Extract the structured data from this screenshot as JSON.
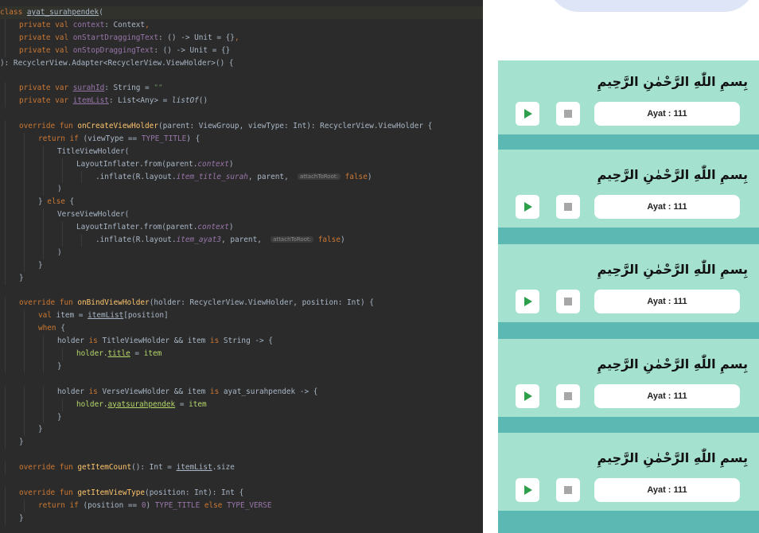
{
  "editor": {
    "lines": [
      {
        "indent": 0,
        "hl": true,
        "segs": [
          [
            "kw",
            "class "
          ],
          [
            "txu",
            "ayat_surahpendek"
          ],
          [
            "tx",
            "("
          ]
        ]
      },
      {
        "indent": 1,
        "segs": [
          [
            "kw",
            "private val "
          ],
          [
            "pp",
            "context"
          ],
          [
            "tx",
            ": Context"
          ],
          [
            "kw",
            ","
          ]
        ]
      },
      {
        "indent": 1,
        "segs": [
          [
            "kw",
            "private val "
          ],
          [
            "pp",
            "onStartDraggingText"
          ],
          [
            "tx",
            ": () -> Unit = {}"
          ],
          [
            "kw",
            ","
          ]
        ]
      },
      {
        "indent": 1,
        "segs": [
          [
            "kw",
            "private val "
          ],
          [
            "pp",
            "onStopDraggingText"
          ],
          [
            "tx",
            ": () -> Unit = {}"
          ]
        ]
      },
      {
        "indent": 0,
        "segs": [
          [
            "tx",
            "): RecyclerView.Adapter<RecyclerView.ViewHolder>() {"
          ]
        ]
      },
      {
        "indent": 0,
        "segs": []
      },
      {
        "indent": 1,
        "segs": [
          [
            "kw",
            "private var "
          ],
          [
            "ppu",
            "surahId"
          ],
          [
            "tx",
            ": String = "
          ],
          [
            "st",
            "\"\""
          ]
        ]
      },
      {
        "indent": 1,
        "segs": [
          [
            "kw",
            "private var "
          ],
          [
            "ppu",
            "itemList"
          ],
          [
            "tx",
            ": List<Any> = "
          ],
          [
            "ic",
            "listOf"
          ],
          [
            "tx",
            "()"
          ]
        ]
      },
      {
        "indent": 0,
        "segs": []
      },
      {
        "indent": 1,
        "segs": [
          [
            "kw",
            "override fun "
          ],
          [
            "fn",
            "onCreateViewHolder"
          ],
          [
            "tx",
            "(parent: ViewGroup, viewType: Int): RecyclerView.ViewHolder {"
          ]
        ]
      },
      {
        "indent": 2,
        "segs": [
          [
            "kw",
            "return if "
          ],
          [
            "tx",
            "(viewType == "
          ],
          [
            "pp",
            "TYPE_TITLE"
          ],
          [
            "tx",
            ") {"
          ]
        ]
      },
      {
        "indent": 3,
        "segs": [
          [
            "tx",
            "TitleViewHolder("
          ]
        ]
      },
      {
        "indent": 4,
        "segs": [
          [
            "tx",
            "LayoutInflater.from(parent."
          ],
          [
            "it",
            "context"
          ],
          [
            "tx",
            ")"
          ]
        ]
      },
      {
        "indent": 5,
        "segs": [
          [
            "tx",
            ".inflate(R.layout."
          ],
          [
            "it",
            "item_title_surah"
          ],
          [
            "tx",
            ", parent,  "
          ],
          [
            "hint",
            "attachToRoot:"
          ],
          [
            "kw",
            " false"
          ],
          [
            "tx",
            ")"
          ]
        ]
      },
      {
        "indent": 3,
        "segs": [
          [
            "tx",
            ")"
          ]
        ]
      },
      {
        "indent": 2,
        "segs": [
          [
            "tx",
            "} "
          ],
          [
            "kw",
            "else "
          ],
          [
            "tx",
            "{"
          ]
        ]
      },
      {
        "indent": 3,
        "segs": [
          [
            "tx",
            "VerseViewHolder("
          ]
        ]
      },
      {
        "indent": 4,
        "segs": [
          [
            "tx",
            "LayoutInflater.from(parent."
          ],
          [
            "it",
            "context"
          ],
          [
            "tx",
            ")"
          ]
        ]
      },
      {
        "indent": 5,
        "segs": [
          [
            "tx",
            ".inflate(R.layout."
          ],
          [
            "it",
            "item_ayat3"
          ],
          [
            "tx",
            ", parent,  "
          ],
          [
            "hint",
            "attachToRoot:"
          ],
          [
            "kw",
            " false"
          ],
          [
            "tx",
            ")"
          ]
        ]
      },
      {
        "indent": 3,
        "segs": [
          [
            "tx",
            ")"
          ]
        ]
      },
      {
        "indent": 2,
        "segs": [
          [
            "tx",
            "}"
          ]
        ]
      },
      {
        "indent": 1,
        "segs": [
          [
            "tx",
            "}"
          ]
        ]
      },
      {
        "indent": 0,
        "segs": []
      },
      {
        "indent": 1,
        "segs": [
          [
            "kw",
            "override fun "
          ],
          [
            "fn",
            "onBindViewHolder"
          ],
          [
            "tx",
            "(holder: RecyclerView.ViewHolder, position: Int) {"
          ]
        ]
      },
      {
        "indent": 2,
        "segs": [
          [
            "kw",
            "val "
          ],
          [
            "tx",
            "item = "
          ],
          [
            "txu",
            "itemList"
          ],
          [
            "tx",
            "[position]"
          ]
        ]
      },
      {
        "indent": 2,
        "segs": [
          [
            "kw",
            "when "
          ],
          [
            "tx",
            "{"
          ]
        ]
      },
      {
        "indent": 3,
        "segs": [
          [
            "tx",
            "holder "
          ],
          [
            "kw",
            "is "
          ],
          [
            "tx",
            "TitleViewHolder && item "
          ],
          [
            "kw",
            "is "
          ],
          [
            "tx",
            "String -> {"
          ]
        ]
      },
      {
        "indent": 4,
        "segs": [
          [
            "vr",
            "holder."
          ],
          [
            "vru",
            "title"
          ],
          [
            "tx",
            " = "
          ],
          [
            "vr",
            "item"
          ]
        ]
      },
      {
        "indent": 3,
        "segs": [
          [
            "tx",
            "}"
          ]
        ]
      },
      {
        "indent": 0,
        "segs": []
      },
      {
        "indent": 3,
        "segs": [
          [
            "tx",
            "holder "
          ],
          [
            "kw",
            "is "
          ],
          [
            "tx",
            "VerseViewHolder && item "
          ],
          [
            "kw",
            "is "
          ],
          [
            "tx",
            "ayat_surahpendek -> {"
          ]
        ]
      },
      {
        "indent": 4,
        "segs": [
          [
            "vr",
            "holder."
          ],
          [
            "vru",
            "ayatsurahpendek"
          ],
          [
            "tx",
            " = "
          ],
          [
            "vr",
            "item"
          ]
        ]
      },
      {
        "indent": 3,
        "segs": [
          [
            "tx",
            "}"
          ]
        ]
      },
      {
        "indent": 2,
        "segs": [
          [
            "tx",
            "}"
          ]
        ]
      },
      {
        "indent": 1,
        "segs": [
          [
            "tx",
            "}"
          ]
        ]
      },
      {
        "indent": 0,
        "segs": []
      },
      {
        "indent": 1,
        "segs": [
          [
            "kw",
            "override fun "
          ],
          [
            "fn",
            "getItemCount"
          ],
          [
            "tx",
            "(): Int = "
          ],
          [
            "txu",
            "itemList"
          ],
          [
            "tx",
            ".size"
          ]
        ]
      },
      {
        "indent": 0,
        "segs": []
      },
      {
        "indent": 1,
        "segs": [
          [
            "kw",
            "override fun "
          ],
          [
            "fn",
            "getItemViewType"
          ],
          [
            "tx",
            "(position: Int): Int {"
          ]
        ]
      },
      {
        "indent": 2,
        "segs": [
          [
            "kw",
            "return if "
          ],
          [
            "tx",
            "(position == "
          ],
          [
            "pp",
            "0"
          ],
          [
            "tx",
            ") "
          ],
          [
            "pp",
            "TYPE_TITLE "
          ],
          [
            "kw",
            "else "
          ],
          [
            "pp",
            "TYPE_VERSE"
          ]
        ]
      },
      {
        "indent": 1,
        "segs": [
          [
            "tx",
            "}"
          ]
        ]
      }
    ]
  },
  "preview": {
    "cards": [
      {
        "arabic": "بِسمِ اللّٰهِ الرَّحْمٰنِ الرَّحِيمِ",
        "label": "Ayat : 111"
      },
      {
        "arabic": "بِسمِ اللّٰهِ الرَّحْمٰنِ الرَّحِيمِ",
        "label": "Ayat : 111"
      },
      {
        "arabic": "بِسمِ اللّٰهِ الرَّحْمٰنِ الرَّحِيمِ",
        "label": "Ayat : 111"
      },
      {
        "arabic": "بِسمِ اللّٰهِ الرَّحْمٰنِ الرَّحِيمِ",
        "label": "Ayat : 111"
      },
      {
        "arabic": "بِسمِ اللّٰهِ الرَّحْمٰنِ الرَّحِيمِ",
        "label": "Ayat : 111"
      }
    ],
    "icons": {
      "play": "play-icon",
      "stop": "stop-icon"
    },
    "colors": {
      "card": "#a4e2cf",
      "divider": "#5cb8b2",
      "play": "#2e9f4a",
      "stop": "#a7a7a7"
    }
  }
}
